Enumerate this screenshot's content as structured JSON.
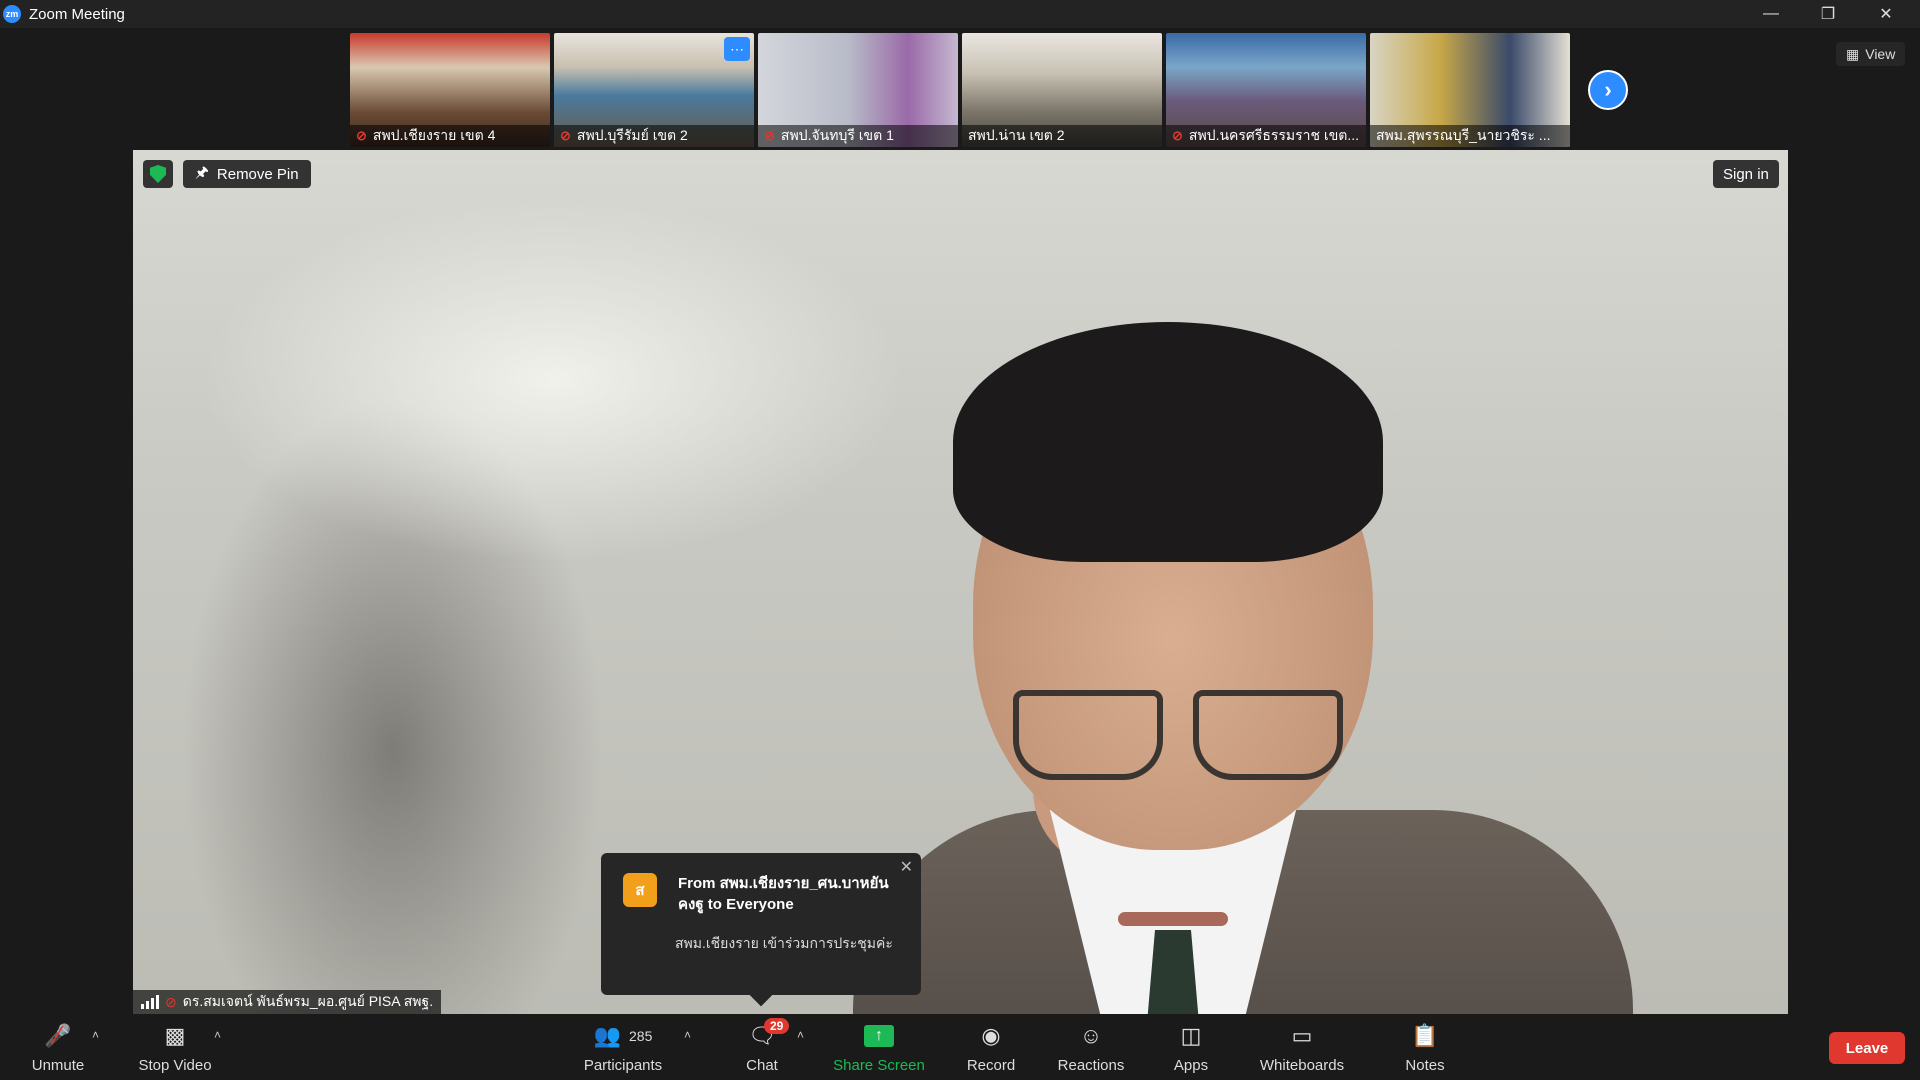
{
  "window": {
    "title": "Zoom Meeting",
    "logo_text": "zm"
  },
  "thumbnails": [
    {
      "label": "สพป.เชียงราย เขต 4",
      "muted": true,
      "bg": "#8a6a52"
    },
    {
      "label": "สพป.บุรีรัมย์ เขต 2",
      "muted": true,
      "bg": "#7d8a96"
    },
    {
      "label": "สพป.จันทบุรี เขต 1",
      "muted": true,
      "bg": "#a2a4b0"
    },
    {
      "label": "สพป.น่าน เขต 2",
      "muted": false,
      "bg": "#8e8a7e"
    },
    {
      "label": "สพป.นครศรีธรรมราช เขต...",
      "muted": true,
      "bg": "#6a7a96"
    },
    {
      "label": "สพม.สุพรรณบุรี_นายวชิระ ...",
      "muted": false,
      "bg": "#9a8a62"
    }
  ],
  "view_button": {
    "label": "View"
  },
  "pin": {
    "remove_label": "Remove Pin"
  },
  "sign_in": {
    "label": "Sign in"
  },
  "speaker": {
    "name": "ดร.สมเจตน์ พันธ์พรม_ผอ.ศูนย์ PISA สพฐ."
  },
  "chat_notification": {
    "avatar_letter": "ส",
    "from": "From สพม.เชียงราย_ศน.บาหยัน คงฐู to Everyone",
    "message": "สพม.เชียงราย เข้าร่วมการประชุมค่ะ"
  },
  "toolbar": {
    "unmute": "Unmute",
    "stop_video": "Stop Video",
    "participants": "Participants",
    "participants_count": "285",
    "chat": "Chat",
    "chat_badge": "29",
    "share_screen": "Share Screen",
    "record": "Record",
    "reactions": "Reactions",
    "apps": "Apps",
    "whiteboards": "Whiteboards",
    "notes": "Notes",
    "leave": "Leave"
  },
  "colors": {
    "accent": "#2d8cff",
    "leave": "#e0372e",
    "share": "#1db954",
    "badge": "#e0372e",
    "avatar": "#f2a01c"
  }
}
